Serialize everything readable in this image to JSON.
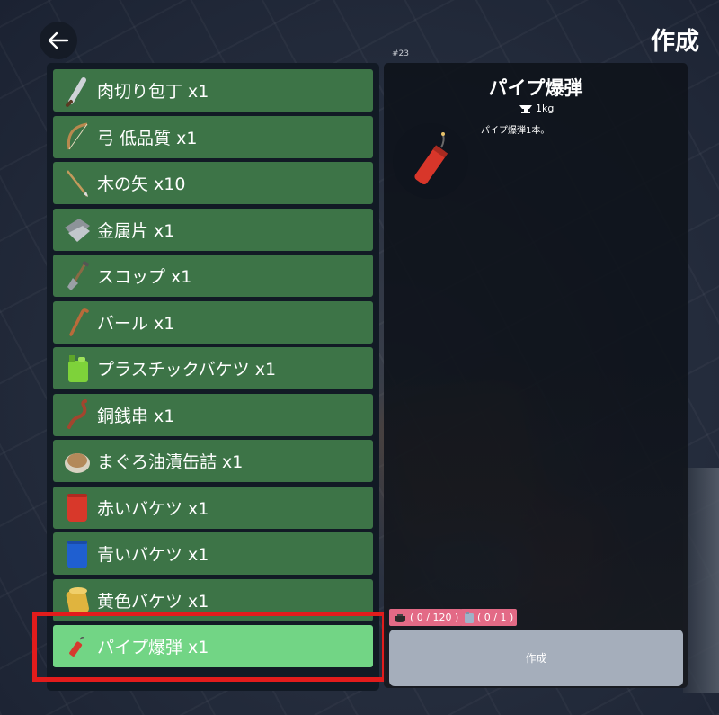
{
  "header": {
    "title": "作成",
    "recipe_id": "#23"
  },
  "items": [
    {
      "label": "肉切り包丁 x1",
      "icon": "cleaver-icon"
    },
    {
      "label": "弓 低品質 x1",
      "icon": "bow-icon"
    },
    {
      "label": "木の矢 x10",
      "icon": "arrow-icon"
    },
    {
      "label": "金属片 x1",
      "icon": "metal-scrap-icon"
    },
    {
      "label": "スコップ x1",
      "icon": "shovel-icon"
    },
    {
      "label": "バール x1",
      "icon": "crowbar-icon"
    },
    {
      "label": "プラスチックバケツ x1",
      "icon": "plastic-jerrycan-icon"
    },
    {
      "label": "銅銭串 x1",
      "icon": "copper-coin-string-icon"
    },
    {
      "label": "まぐろ油漬缶詰 x1",
      "icon": "tuna-can-icon"
    },
    {
      "label": "赤いバケツ x1",
      "icon": "red-barrel-icon"
    },
    {
      "label": "青いバケツ x1",
      "icon": "blue-barrel-icon"
    },
    {
      "label": "黄色バケツ x1",
      "icon": "yellow-barrel-icon"
    },
    {
      "label": "パイプ爆弾 x1",
      "icon": "pipe-bomb-icon",
      "selected": true
    }
  ],
  "detail": {
    "title": "パイプ爆弾",
    "weight": "1kg",
    "description": "パイプ爆弾1本。",
    "image_icon": "pipe-bomb-icon"
  },
  "requirements": [
    {
      "icon": "pot-icon",
      "text": "( 0 / 120 )"
    },
    {
      "icon": "canister-icon",
      "text": "( 0 / 1 )"
    }
  ],
  "craft_button": {
    "label": "作成"
  },
  "colors": {
    "row": "#3d7447",
    "row_selected": "#72d585",
    "highlight": "#e21c1c",
    "badge": "#e36a86",
    "craft_button": "#a5aebb"
  }
}
